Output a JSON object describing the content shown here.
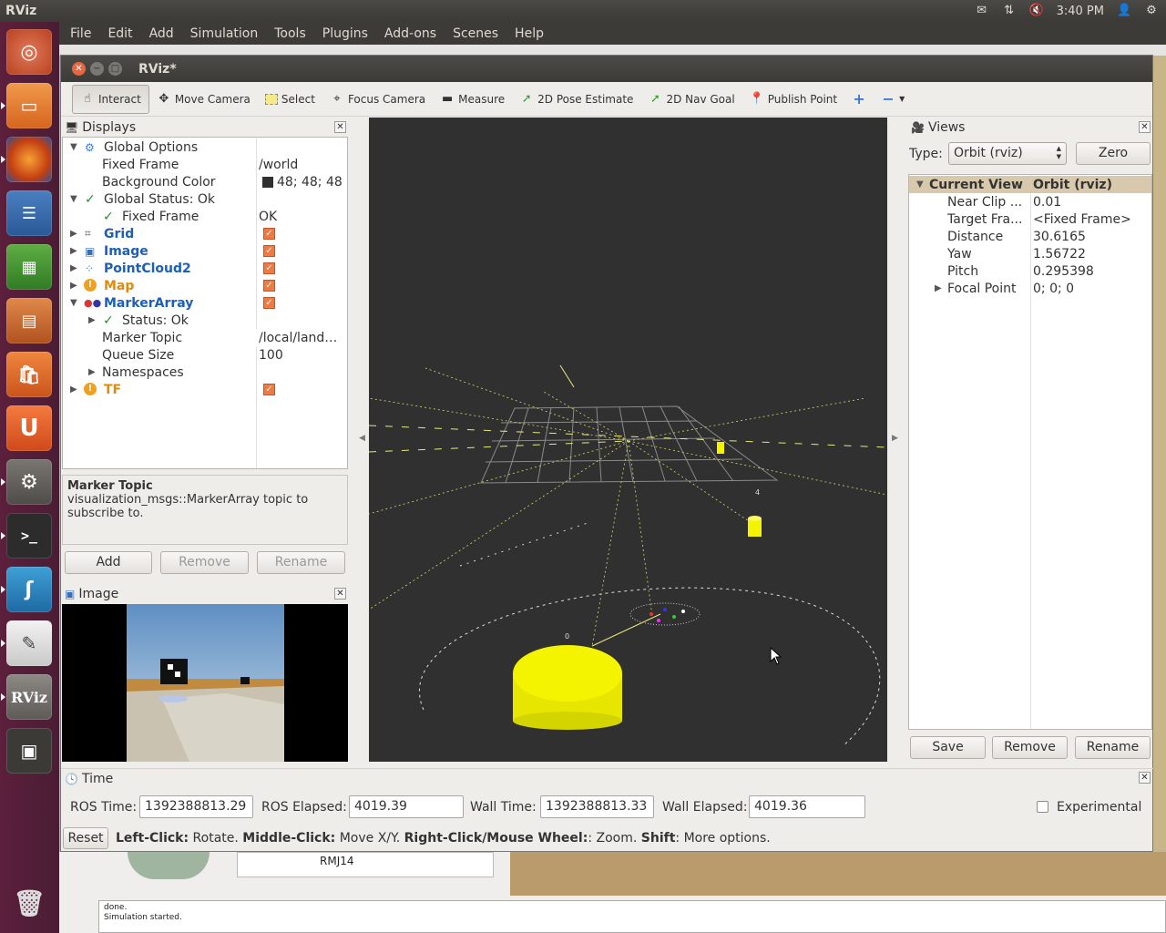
{
  "topbar": {
    "app_name": "RViz",
    "time": "3:40 PM"
  },
  "launcher": {
    "items": [
      "ubuntu-home-icon",
      "files-icon",
      "firefox-icon",
      "writer-icon",
      "calc-icon",
      "impress-icon",
      "software-center-icon",
      "ubuntu-one-icon",
      "system-settings-icon",
      "terminal-icon",
      "gazebo-icon",
      "text-editor-icon",
      "rviz-icon",
      "workspace-switcher-icon",
      "trash-icon"
    ],
    "rviz_label": "RViz"
  },
  "menubar": {
    "items": [
      "File",
      "Edit",
      "Add",
      "Simulation",
      "Tools",
      "Plugins",
      "Add-ons",
      "Scenes",
      "Help"
    ]
  },
  "window": {
    "title": "RViz*"
  },
  "toolbar": {
    "interact": "Interact",
    "move_camera": "Move Camera",
    "select": "Select",
    "focus_camera": "Focus Camera",
    "measure": "Measure",
    "pose_estimate": "2D Pose Estimate",
    "nav_goal": "2D Nav Goal",
    "publish_point": "Publish Point"
  },
  "displays": {
    "title": "Displays",
    "rows": {
      "global_options": "Global Options",
      "fixed_frame": "Fixed Frame",
      "fixed_frame_val": "/world",
      "background_color": "Background Color",
      "background_color_val": "48; 48; 48",
      "global_status": "Global Status: Ok",
      "fixed_frame_status": "Fixed Frame",
      "fixed_frame_status_val": "OK",
      "grid": "Grid",
      "image": "Image",
      "pointcloud2": "PointCloud2",
      "map": "Map",
      "markerarray": "MarkerArray",
      "status_ok": "Status: Ok",
      "marker_topic": "Marker Topic",
      "marker_topic_val": "/local/land…",
      "queue_size": "Queue Size",
      "queue_size_val": "100",
      "namespaces": "Namespaces",
      "tf": "TF"
    },
    "description_title": "Marker Topic",
    "description_text": "visualization_msgs::MarkerArray topic to subscribe to.",
    "add": "Add",
    "remove": "Remove",
    "rename": "Rename"
  },
  "image_panel": {
    "title": "Image"
  },
  "views": {
    "title": "Views",
    "type_label": "Type:",
    "type_value": "Orbit (rviz)",
    "zero": "Zero",
    "header_name": "Current View",
    "header_value": "Orbit (rviz)",
    "rows": [
      {
        "label": "Near Clip ...",
        "value": "0.01"
      },
      {
        "label": "Target Fra...",
        "value": "<Fixed Frame>"
      },
      {
        "label": "Distance",
        "value": "30.6165"
      },
      {
        "label": "Yaw",
        "value": "1.56722"
      },
      {
        "label": "Pitch",
        "value": "0.295398"
      },
      {
        "label": "Focal Point",
        "value": "0; 0; 0"
      }
    ],
    "save": "Save",
    "remove": "Remove",
    "rename": "Rename"
  },
  "time_panel": {
    "title": "Time",
    "ros_time_label": "ROS Time:",
    "ros_time": "1392388813.29",
    "ros_elapsed_label": "ROS Elapsed:",
    "ros_elapsed": "4019.39",
    "wall_time_label": "Wall Time:",
    "wall_time": "1392388813.33",
    "wall_elapsed_label": "Wall Elapsed:",
    "wall_elapsed": "4019.36",
    "experimental": "Experimental",
    "reset": "Reset",
    "hint_left_click": "Left-Click:",
    "hint_rotate": "Rotate.",
    "hint_middle_click": "Middle-Click:",
    "hint_move": "Move X/Y.",
    "hint_right_click": "Right-Click/Mouse Wheel:",
    "hint_zoom": ": Zoom.",
    "hint_shift": "Shift",
    "hint_more": ": More options."
  },
  "background_app": {
    "tree_item": "RMJ14",
    "status_line1": "done.",
    "status_line2": "Simulation started."
  },
  "colors": {
    "viewport_bg": "#303030",
    "launcher_bg": "#5c1f3c",
    "checkbox": "#f07a44",
    "link_blue": "#1b5fb8",
    "warn_orange": "#e08a0c",
    "marker_yellow": "#f4f400"
  }
}
